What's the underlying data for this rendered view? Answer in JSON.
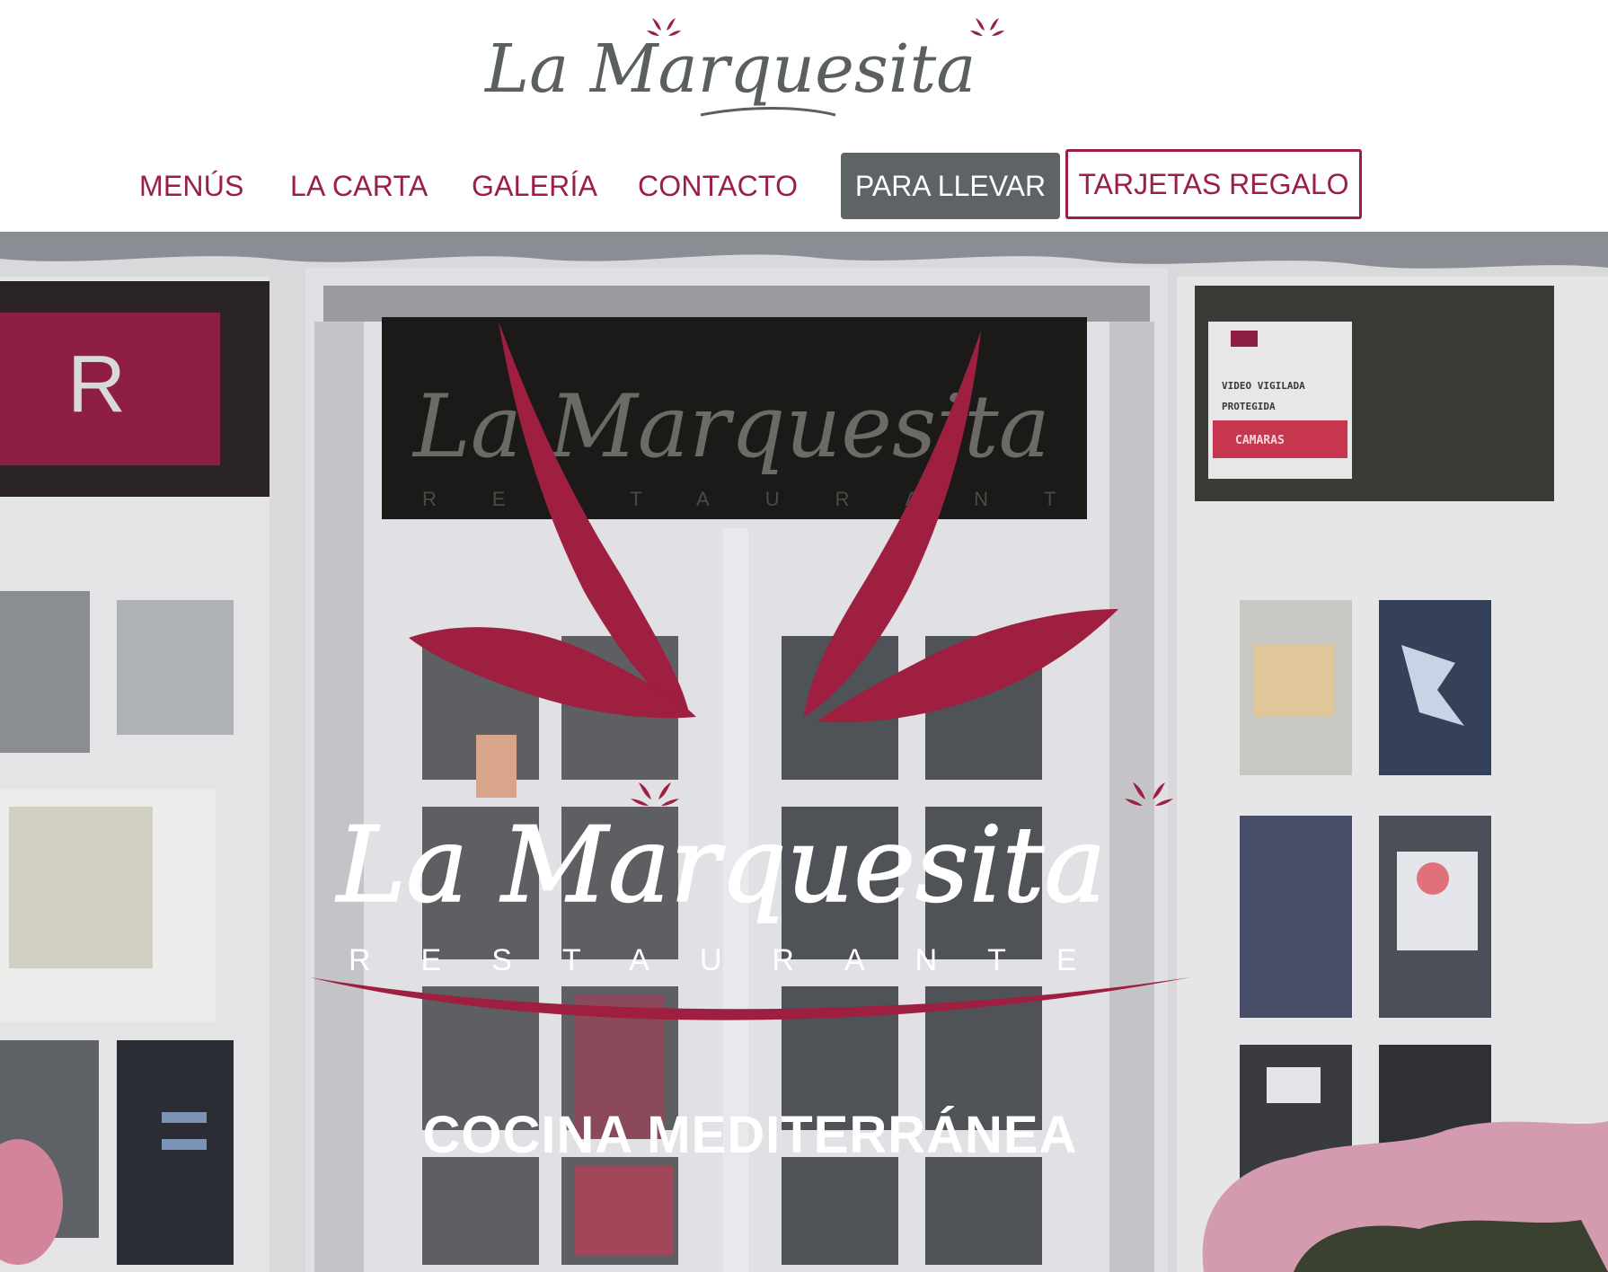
{
  "header": {
    "logo_text": "La Marquesita"
  },
  "nav": {
    "items": [
      {
        "label": "MENÚS"
      },
      {
        "label": "LA CARTA"
      },
      {
        "label": "GALERÍA"
      },
      {
        "label": "CONTACTO"
      }
    ],
    "takeaway_label": "PARA LLEVAR",
    "gift_cards_label": "TARJETAS REGALO"
  },
  "hero": {
    "logo_text": "La Marquesita",
    "logo_subtitle": "RESTAURANTE",
    "tagline": "COCINA MEDITERRÁNEA",
    "awning_sign_text": "La Marquesita",
    "awning_sign_subtext": "RESTAURANTE",
    "left_sign_letter": "R",
    "right_sign_lines": [
      "VIDEO VIGILADA",
      "PROTEGIDA",
      "CAMARAS"
    ]
  },
  "colors": {
    "brand": "#9b1f45",
    "button_gray": "#5e6365",
    "logo_gray": "#5a5f60"
  }
}
